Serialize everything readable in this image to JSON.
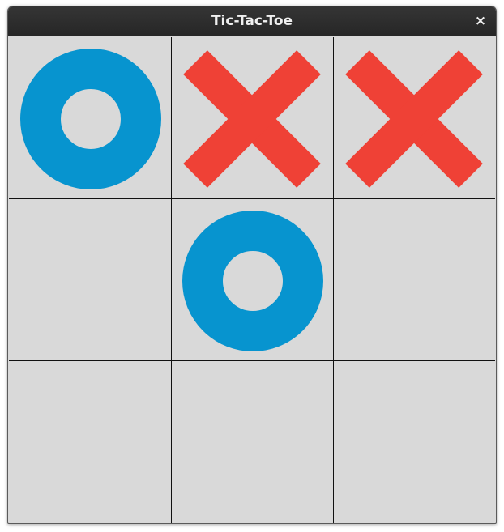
{
  "window": {
    "title": "Tic-Tac-Toe",
    "close_label": "×"
  },
  "colors": {
    "o_mark": "#0794cf",
    "x_mark": "#ef4136",
    "board_bg": "#d9d9d9",
    "grid_line": "#111111",
    "titlebar_bg": "#2b2b2b"
  },
  "board": [
    [
      "O",
      "X",
      "X"
    ],
    [
      "",
      "O",
      ""
    ],
    [
      "",
      "",
      ""
    ]
  ]
}
